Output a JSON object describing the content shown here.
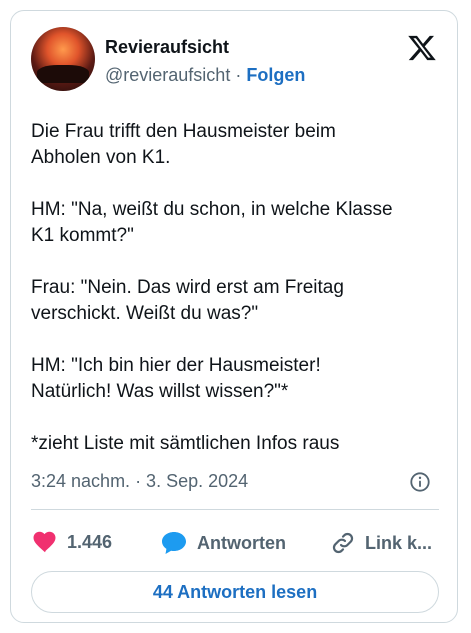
{
  "author": {
    "name": "Revieraufsicht",
    "handle": "@revieraufsicht",
    "separator": " · ",
    "follow_label": "Folgen"
  },
  "tweet": {
    "text": "Die Frau trifft den Hausmeister beim\nAbholen von K1.\n\nHM: \"Na, weißt du schon, in welche Klasse\nK1 kommt?\"\n\nFrau: \"Nein. Das wird erst am Freitag\nverschickt. Weißt du was?\"\n\nHM: \"Ich bin hier der Hausmeister!\nNatürlich! Was willst wissen?\"*\n\n*zieht Liste mit sämtlichen Infos raus",
    "timestamp": "3:24 nachm. · 3. Sep. 2024"
  },
  "actions": {
    "like_count": "1.446",
    "reply_label": "Antworten",
    "link_label": "Link k..."
  },
  "read_replies_label": "44 Antworten lesen",
  "icons": {
    "platform": "x-logo-icon",
    "info": "info-icon",
    "like": "heart-icon",
    "reply": "speech-bubble-icon",
    "link": "chain-link-icon"
  },
  "colors": {
    "accent": "#1d6fc2",
    "heart": "#f0306f",
    "reply_icon": "#1d9bf0",
    "muted": "#536471",
    "border": "#cfd9de"
  }
}
